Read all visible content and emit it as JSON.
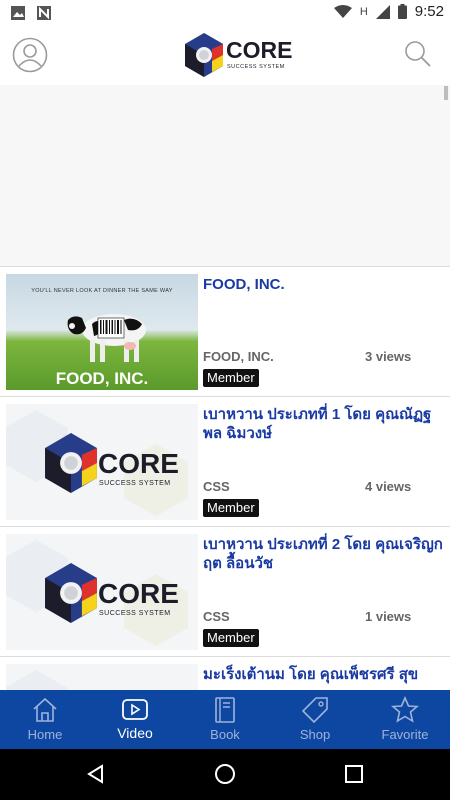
{
  "status_bar": {
    "time": "9:52",
    "network_label": "H"
  },
  "header": {
    "logo": {
      "word": "CORE",
      "tagline": "SUCCESS SYSTEM"
    }
  },
  "videos": [
    {
      "title": "FOOD, INC.",
      "category": "FOOD, INC.",
      "views": "3 views",
      "badge": "Member",
      "thumbnail": {
        "kind": "poster",
        "tagline": "YOU'LL NEVER LOOK AT DINNER THE SAME WAY",
        "poster_title": "FOOD, INC."
      }
    },
    {
      "title": "เบาหวาน ประเภทที่ 1 โดย คุณณัฏฐพล ฉิมวงษ์",
      "category": "CSS",
      "views": "4 views",
      "badge": "Member",
      "thumbnail": {
        "kind": "logo",
        "word": "CORE",
        "tagline": "SUCCESS SYSTEM"
      }
    },
    {
      "title": "เบาหวาน ประเภทที่ 2 โดย คุณเจริญกฤต ลื้อนวัช",
      "category": "CSS",
      "views": "1 views",
      "badge": "Member",
      "thumbnail": {
        "kind": "logo",
        "word": "CORE",
        "tagline": "SUCCESS SYSTEM"
      }
    },
    {
      "title": "มะเร็งเต้านม โดย คุณเพ็ชรศรี สุข",
      "category": "",
      "views": "",
      "badge": "",
      "thumbnail": {
        "kind": "logo",
        "word": "",
        "tagline": ""
      }
    }
  ],
  "bottom_nav": [
    {
      "label": "Home",
      "icon": "home-icon",
      "active": false
    },
    {
      "label": "Video",
      "icon": "video-icon",
      "active": true
    },
    {
      "label": "Book",
      "icon": "book-icon",
      "active": false
    },
    {
      "label": "Shop",
      "icon": "tag-icon",
      "active": false
    },
    {
      "label": "Favorite",
      "icon": "star-icon",
      "active": false
    }
  ],
  "colors": {
    "nav_background": "#0d47a1",
    "title_text": "#1a3aa3",
    "badge_background": "#111111"
  }
}
